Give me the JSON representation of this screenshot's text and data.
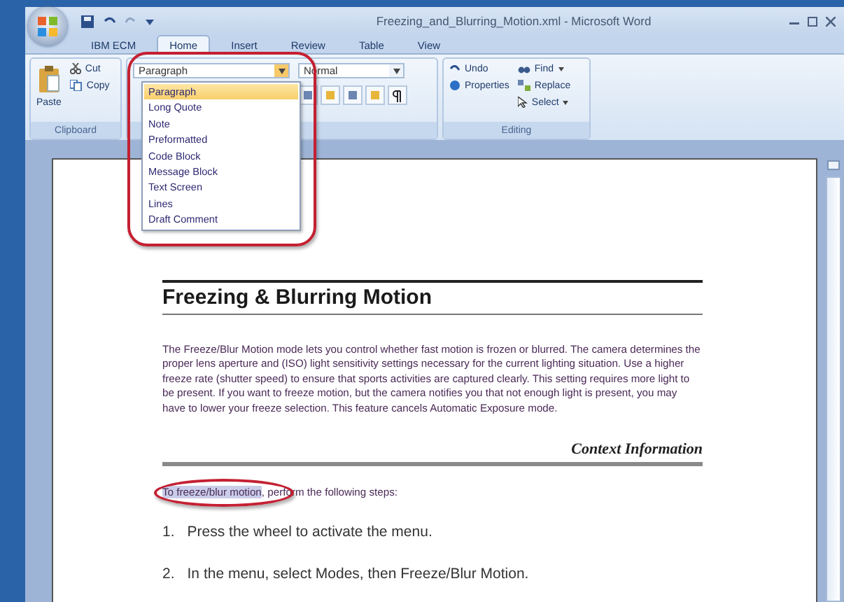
{
  "window": {
    "title": "Freezing_and_Blurring_Motion.xml - Microsoft Word"
  },
  "tabs": [
    {
      "label": "IBM ECM",
      "selected": false
    },
    {
      "label": "Home",
      "selected": true
    },
    {
      "label": "Insert",
      "selected": false
    },
    {
      "label": "Review",
      "selected": false
    },
    {
      "label": "Table",
      "selected": false
    },
    {
      "label": "View",
      "selected": false
    }
  ],
  "clipboard": {
    "paste": "Paste",
    "cut": "Cut",
    "copy": "Copy",
    "label": "Clipboard"
  },
  "styles": {
    "element_select": "Paragraph",
    "style_select": "Normal",
    "options": [
      {
        "label": "Paragraph",
        "selected": true
      },
      {
        "label": "Long Quote",
        "selected": false
      },
      {
        "label": "Note",
        "selected": false
      },
      {
        "label": "Preformatted",
        "selected": false
      },
      {
        "label": "Code Block",
        "selected": false
      },
      {
        "label": "Message Block",
        "selected": false
      },
      {
        "label": "Text Screen",
        "selected": false
      },
      {
        "label": "Lines",
        "selected": false
      },
      {
        "label": "Draft Comment",
        "selected": false
      }
    ]
  },
  "editing": {
    "undo": "Undo",
    "properties": "Properties",
    "find": "Find",
    "replace": "Replace",
    "select": "Select",
    "label": "Editing"
  },
  "document": {
    "heading": "Freezing & Blurring Motion",
    "body": "The Freeze/Blur Motion mode lets you control whether fast motion is frozen or blurred. The camera determines the proper lens aperture and (ISO) light sensitivity settings necessary for the current lighting situation. Use a higher freeze rate (shutter speed) to ensure that sports activities are captured clearly. This setting requires more light to be present. If you want to freeze motion, but the camera notifies you that not enough light is present, you may have to lower your freeze selection. This feature cancels Automatic Exposure mode.",
    "section": "Context Information",
    "intro_highlight": "To freeze/blur motion",
    "intro_rest": ", perform the following steps:",
    "steps": [
      {
        "number": "1.",
        "text": "Press the wheel to activate the menu."
      },
      {
        "number": "2.",
        "text": "In the menu, select Modes, then Freeze/Blur Motion."
      }
    ]
  }
}
